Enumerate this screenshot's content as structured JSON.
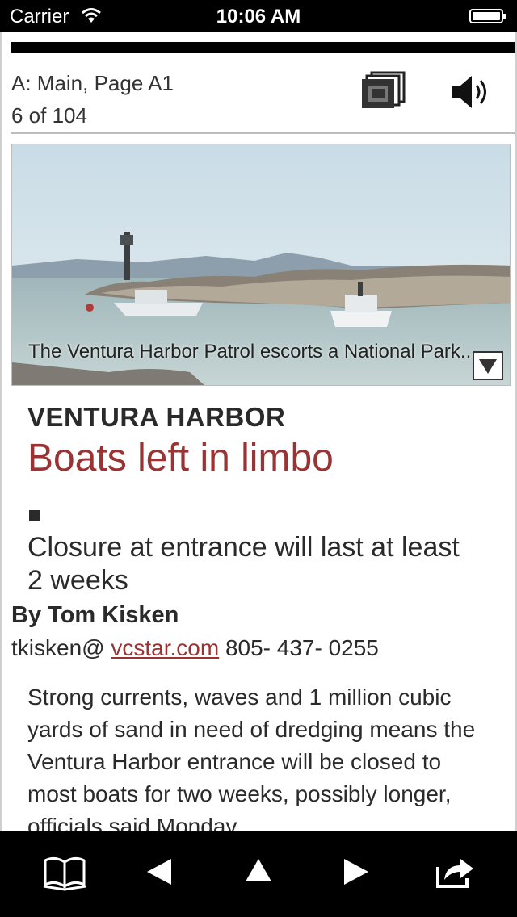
{
  "status_bar": {
    "carrier": "Carrier",
    "time": "10:06 AM",
    "icons": [
      "wifi-icon",
      "battery-icon"
    ]
  },
  "header": {
    "section": "A: Main, Page A1",
    "page_count": "6 of 104",
    "icons": [
      "pages-icon",
      "speaker-icon"
    ]
  },
  "photo": {
    "caption": "The Ventura Harbor Patrol escorts a National Park...",
    "expand_icon": "triangle-down-icon"
  },
  "article": {
    "kicker": "VENTURA HARBOR",
    "headline": "Boats left in limbo",
    "subhead": "Closure at entrance will last at least 2 weeks",
    "byline": "By Tom Kisken",
    "contact_prefix": "tkisken@ ",
    "contact_link": "vcstar.com",
    "contact_phone": " 805- 437- 0255",
    "body": "Strong currents, waves and 1 million cubic yards of sand in need of dredging means the Ventura Harbor entrance will be closed to most boats for two weeks, possibly longer, officials said Monday."
  },
  "toolbar": {
    "icons": [
      "book-icon",
      "previous-icon",
      "up-icon",
      "next-icon",
      "share-icon"
    ]
  },
  "colors": {
    "headline": "#9a3334",
    "link": "#9a3334",
    "bars": "#000000"
  }
}
